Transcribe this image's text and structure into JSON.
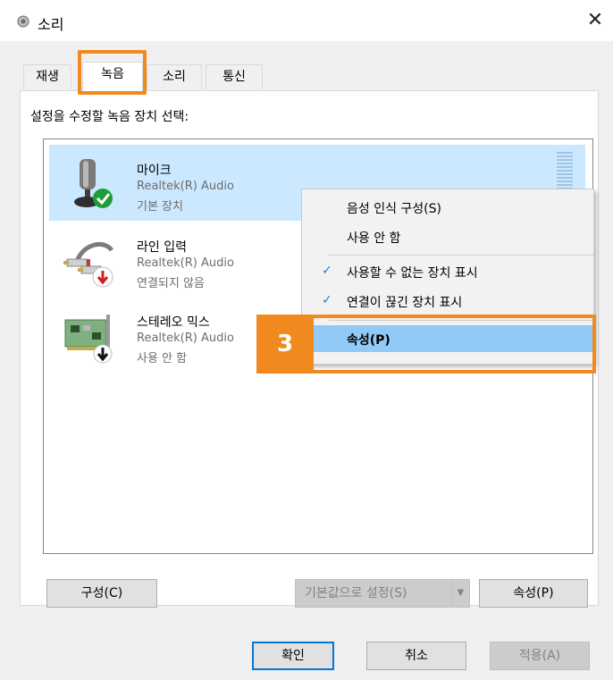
{
  "window": {
    "title": "소리",
    "close_glyph": "✕"
  },
  "tabs": [
    {
      "label": "재생"
    },
    {
      "label": "녹음"
    },
    {
      "label": "소리"
    },
    {
      "label": "통신"
    }
  ],
  "instruction": "설정을 수정할 녹음 장치 선택:",
  "devices": [
    {
      "name": "마이크",
      "driver": "Realtek(R) Audio",
      "status": "기본 장치",
      "icon": "microphone-icon",
      "badge": "green-check"
    },
    {
      "name": "라인 입력",
      "driver": "Realtek(R) Audio",
      "status": "연결되지 않음",
      "icon": "line-in-cable-icon",
      "badge": "red-down-arrow"
    },
    {
      "name": "스테레오 믹스",
      "driver": "Realtek(R) Audio",
      "status": "사용 안 함",
      "icon": "sound-card-icon",
      "badge": "black-down-arrow"
    }
  ],
  "context_menu": {
    "items": [
      {
        "label": "음성 인식 구성(S)",
        "checked": false
      },
      {
        "label": "사용 안 함",
        "checked": false
      },
      {
        "label": "사용할 수 없는 장치 표시",
        "checked": true
      },
      {
        "label": "연결이 끊긴 장치 표시",
        "checked": true
      },
      {
        "label": "속성(P)",
        "checked": false,
        "highlighted": true
      }
    ],
    "check_glyph": "✓"
  },
  "annotation": {
    "step_number": "3",
    "color": "#f08a1e"
  },
  "panel_buttons": {
    "configure": "구성(C)",
    "set_default": "기본값으로 설정(S)",
    "properties": "속성(P)"
  },
  "dialog_buttons": {
    "ok": "확인",
    "cancel": "취소",
    "apply": "적용(A)"
  },
  "colors": {
    "selection": "#cce8ff",
    "menu_highlight": "#91c9f7",
    "check": "#2c7be5",
    "default_button_border": "#0078d7"
  }
}
